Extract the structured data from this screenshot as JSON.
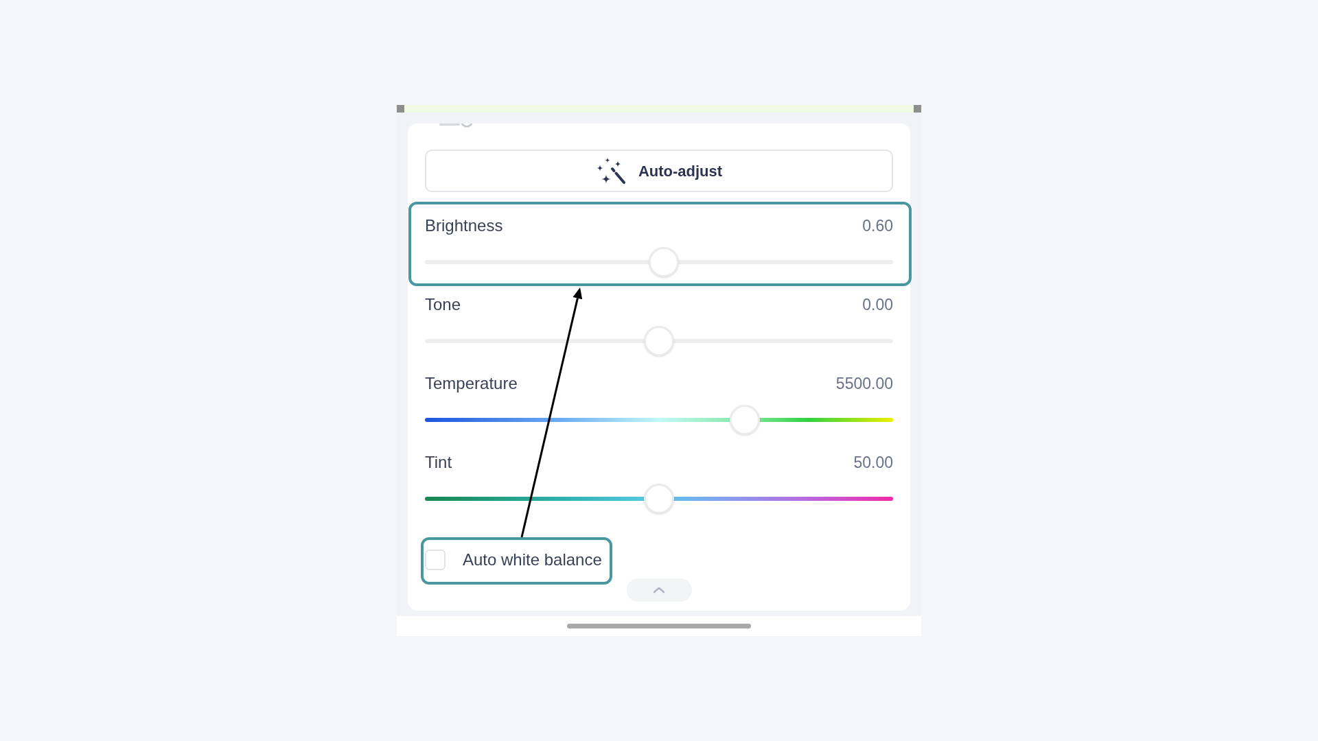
{
  "auto_adjust_button": {
    "label": "Auto-adjust"
  },
  "sliders": [
    {
      "label": "Brightness",
      "value": "0.60",
      "kind": "neutral",
      "level": 0.51,
      "highlighted": true
    },
    {
      "label": "Tone",
      "value": "0.00",
      "kind": "neutral",
      "level": 0.5,
      "highlighted": false
    },
    {
      "label": "Temperature",
      "value": "5500.00",
      "kind": "temperature",
      "level": 0.684,
      "highlighted": false
    },
    {
      "label": "Tint",
      "value": "50.00",
      "kind": "tint",
      "level": 0.5,
      "highlighted": false
    }
  ],
  "auto_white_balance": {
    "label": "Auto white balance",
    "checked": false,
    "highlighted": true
  },
  "annotation_arrow": true
}
